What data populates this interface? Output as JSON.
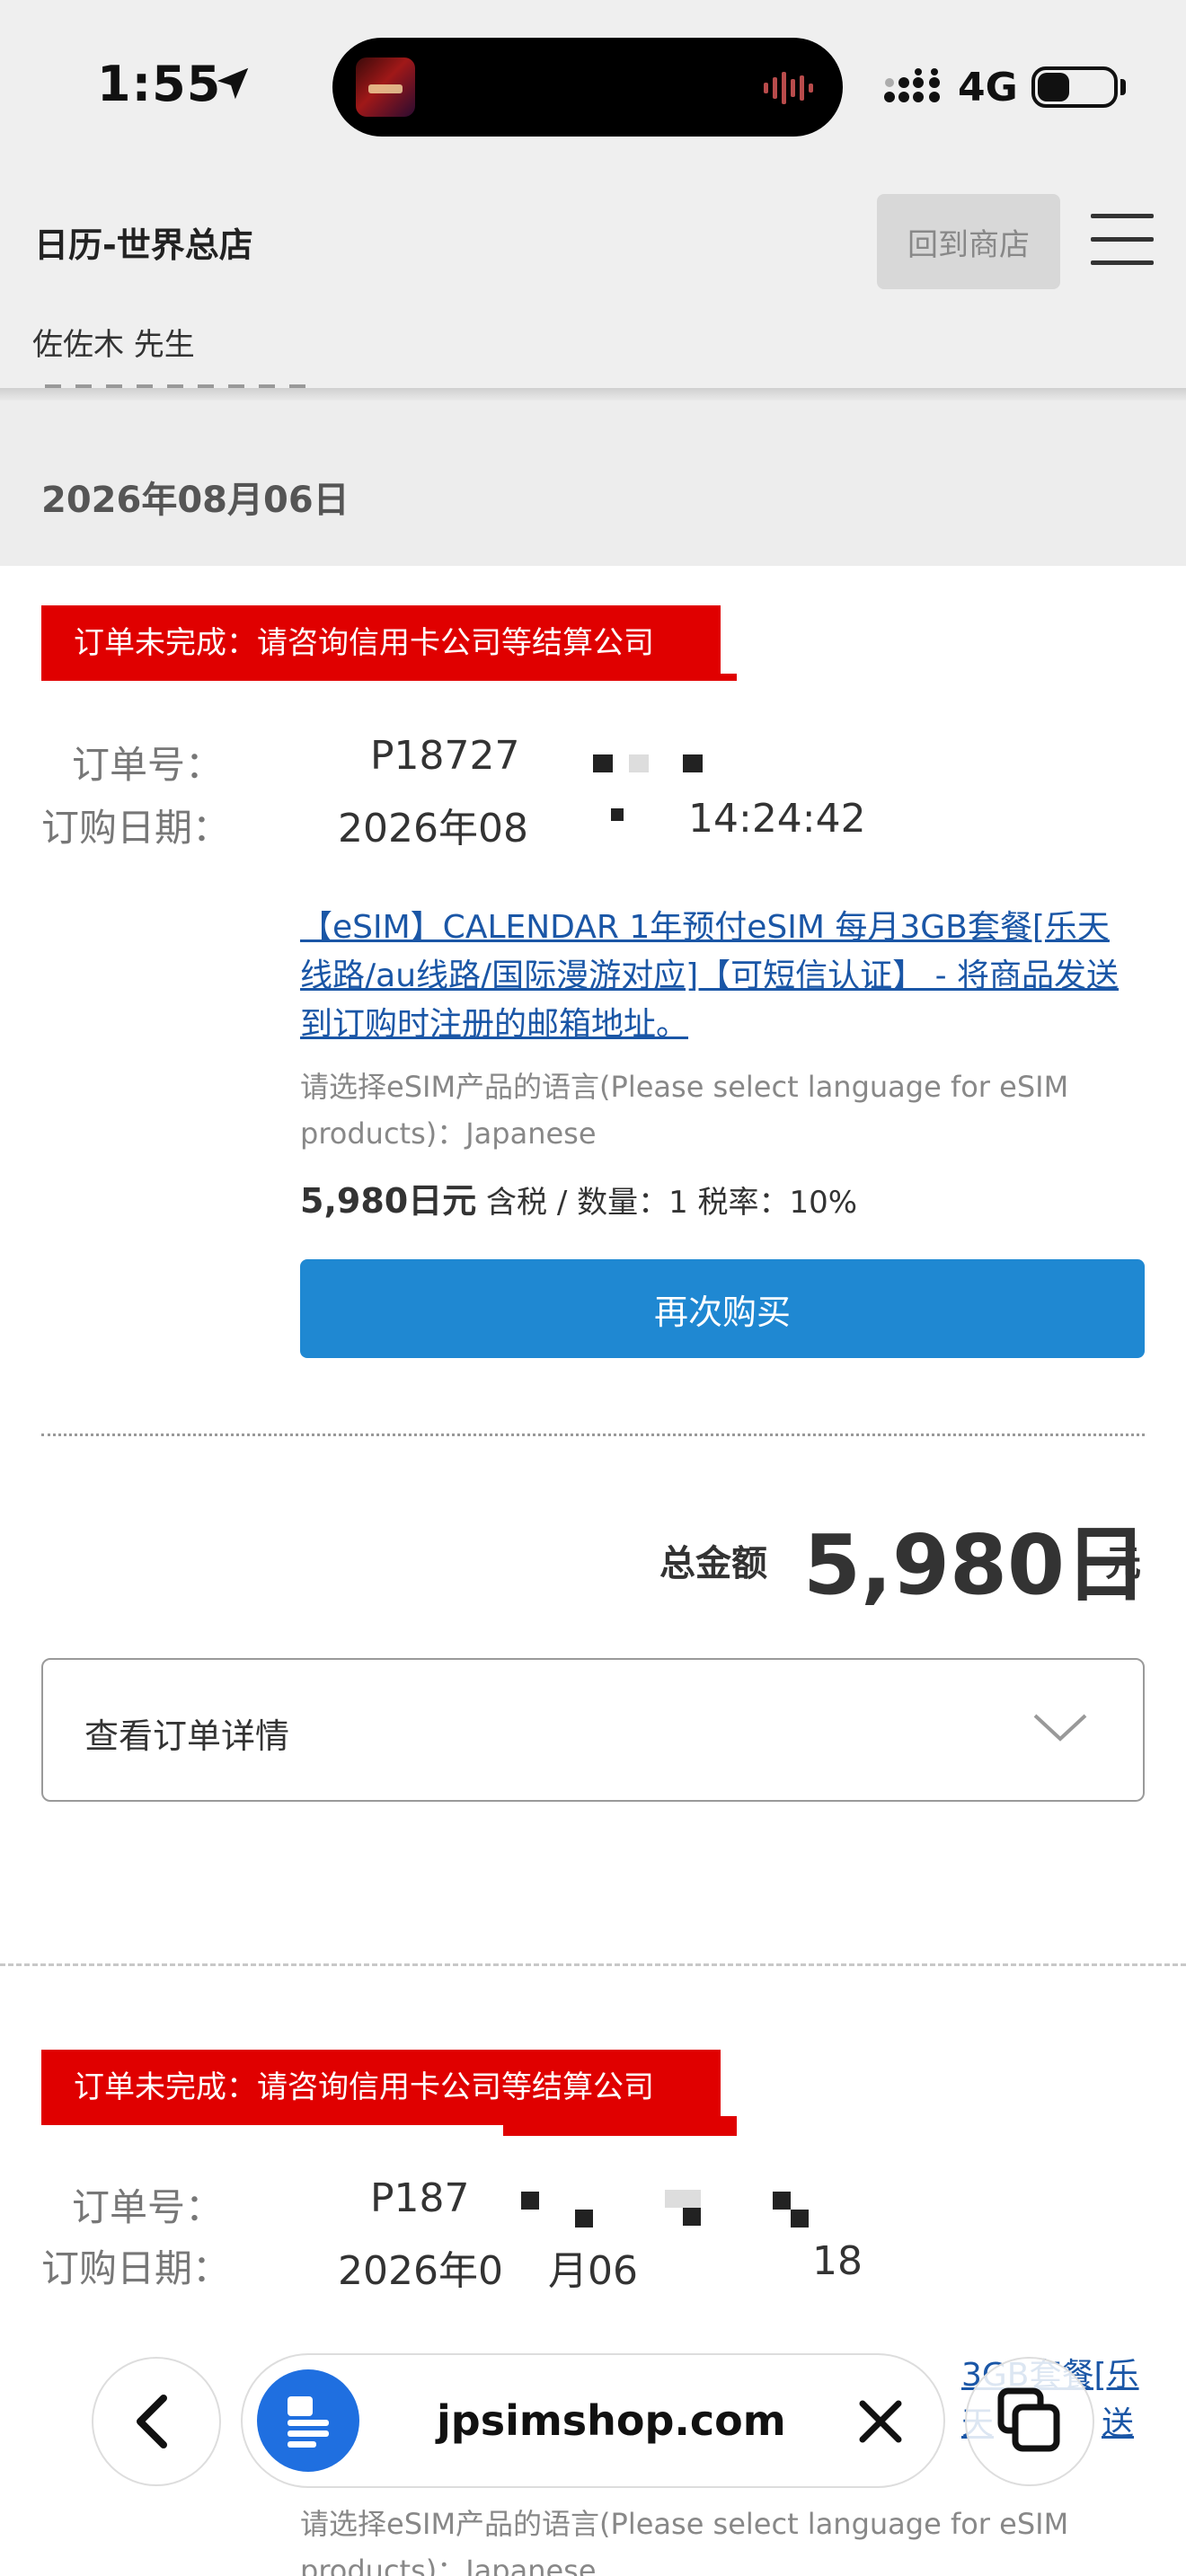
{
  "status_bar": {
    "time": "1:55",
    "network": "4G",
    "battery_level": 0.4,
    "icons": [
      "location-arrow-icon",
      "signal-icon",
      "battery-icon"
    ]
  },
  "header": {
    "store_name": "日历-世界总店",
    "back_to_store_label": "回到商店",
    "user_name": "佐佐木 先生"
  },
  "date_heading": "2026年08月06日",
  "orders": [
    {
      "status_banner": "订单未完成：请咨询信用卡公司等结算公司",
      "order_no_label": "订单号：",
      "order_no": "P18727",
      "order_date_label": "订购日期：",
      "order_date": "2026年08",
      "order_date_suffix": "14:24:42",
      "product_link": "【eSIM】CALENDAR 1年预付eSIM 每月3GB套餐[乐天线路/au线路/国际漫游对应]【可短信认证】 - 将商品发送到订购时注册的邮箱地址。",
      "language_note": "请选择eSIM产品的语言(Please select language for eSIM products)：Japanese",
      "price": "5,980日元",
      "price_detail": "含税 / 数量：1 税率：10%",
      "rebuy_label": "再次购买",
      "total_label": "总金额",
      "total_value": "5,980日",
      "total_unit": "元",
      "details_label": "查看订单详情"
    },
    {
      "status_banner": "订单未完成：请咨询信用卡公司等结算公司",
      "order_no_label": "订单号：",
      "order_no": "P187",
      "order_date_label": "订购日期：",
      "order_date": "2026年0",
      "order_date_mid": "月06",
      "order_date_suffix": "18",
      "product_link_right": "3GB套餐[乐天",
      "product_link_right2": "送",
      "language_note": "请选择eSIM产品的语言(Please select language for eSIM",
      "language_note2": "products)：Japanese"
    }
  ],
  "browser_bar": {
    "url": "jpsimshop.com",
    "icons": [
      "back-chevron-icon",
      "reader-icon",
      "close-icon",
      "tabs-icon"
    ]
  },
  "colors": {
    "banner_red": "#e00000",
    "link_blue": "#1a56a6",
    "button_blue": "#1f88d2"
  }
}
